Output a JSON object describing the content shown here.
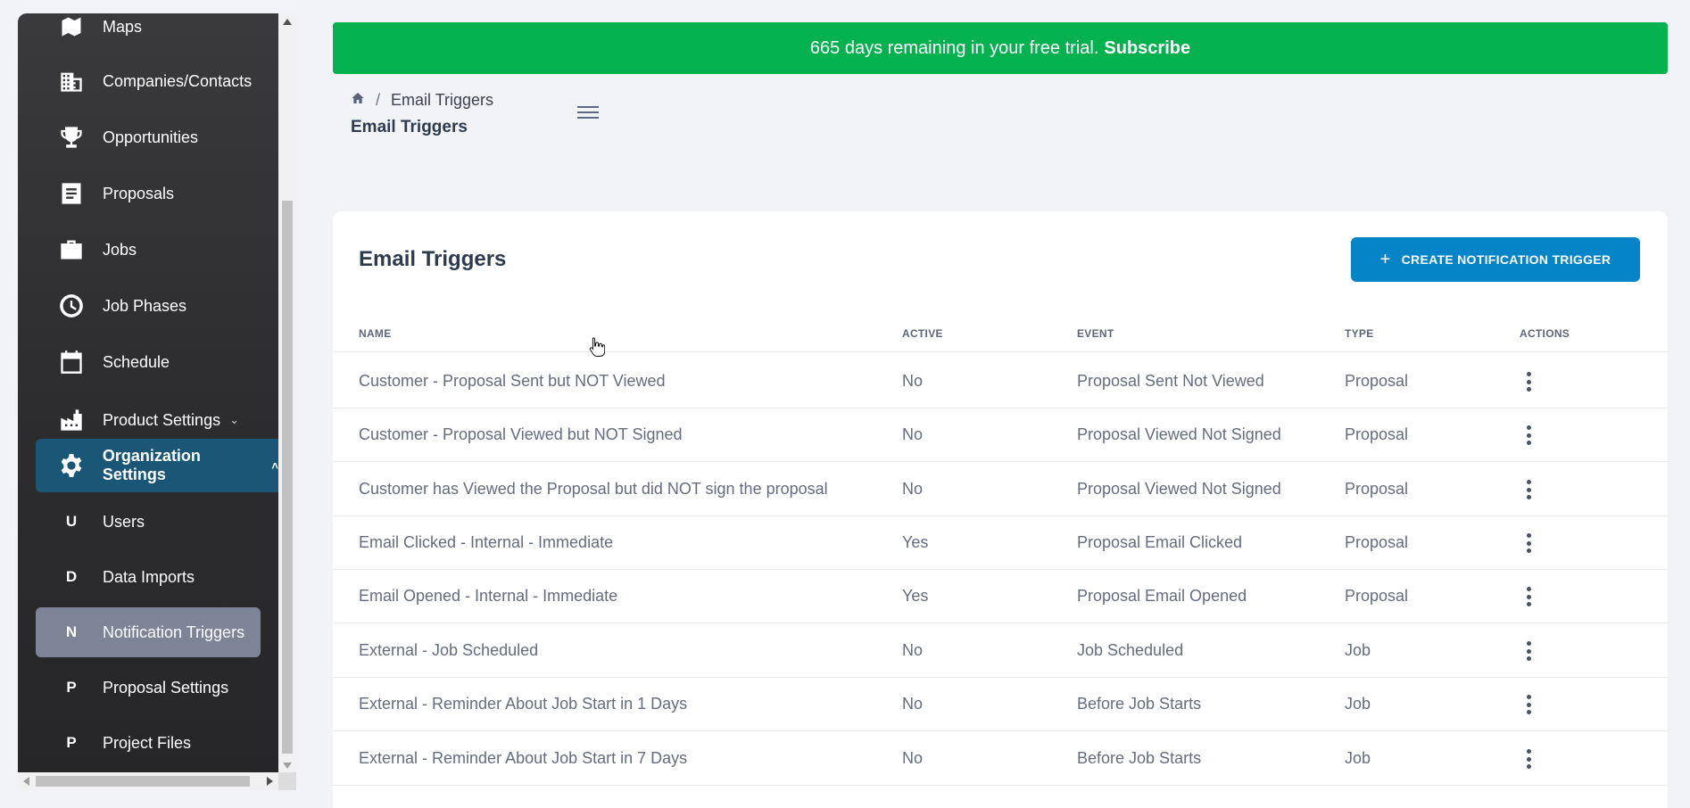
{
  "sidebar": {
    "items": [
      {
        "label": "Maps",
        "icon": "map-icon"
      },
      {
        "label": "Companies/Contacts",
        "icon": "building-icon"
      },
      {
        "label": "Opportunities",
        "icon": "trophy-icon"
      },
      {
        "label": "Proposals",
        "icon": "document-icon"
      },
      {
        "label": "Jobs",
        "icon": "briefcase-icon"
      },
      {
        "label": "Job Phases",
        "icon": "clock-icon"
      },
      {
        "label": "Schedule",
        "icon": "calendar-icon"
      },
      {
        "label": "Product Settings",
        "icon": "factory-icon"
      },
      {
        "label": "Organization Settings",
        "icon": "gear-icon"
      }
    ],
    "subitems": [
      {
        "letter": "U",
        "label": "Users"
      },
      {
        "letter": "D",
        "label": "Data Imports"
      },
      {
        "letter": "N",
        "label": "Notification Triggers"
      },
      {
        "letter": "P",
        "label": "Proposal Settings"
      },
      {
        "letter": "P",
        "label": "Project Files"
      }
    ]
  },
  "banner": {
    "text": "665 days remaining in your free trial.",
    "link": "Subscribe",
    "color": "#03b24f"
  },
  "breadcrumb": {
    "current": "Email Triggers"
  },
  "page_title": "Email Triggers",
  "card": {
    "title": "Email Triggers",
    "create_button": "CREATE NOTIFICATION TRIGGER"
  },
  "table": {
    "headers": {
      "name": "NAME",
      "active": "ACTIVE",
      "event": "EVENT",
      "type": "TYPE",
      "actions": "ACTIONS"
    },
    "rows": [
      {
        "name": "Customer - Proposal Sent but NOT Viewed",
        "active": "No",
        "event": "Proposal Sent Not Viewed",
        "type": "Proposal"
      },
      {
        "name": "Customer - Proposal Viewed but NOT Signed",
        "active": "No",
        "event": "Proposal Viewed Not Signed",
        "type": "Proposal"
      },
      {
        "name": "Customer has Viewed the Proposal but did NOT sign the proposal",
        "active": "No",
        "event": "Proposal Viewed Not Signed",
        "type": "Proposal"
      },
      {
        "name": "Email Clicked - Internal - Immediate",
        "active": "Yes",
        "event": "Proposal Email Clicked",
        "type": "Proposal"
      },
      {
        "name": "Email Opened - Internal - Immediate",
        "active": "Yes",
        "event": "Proposal Email Opened",
        "type": "Proposal"
      },
      {
        "name": "External - Job Scheduled",
        "active": "No",
        "event": "Job Scheduled",
        "type": "Job"
      },
      {
        "name": "External - Reminder About Job Start in 1 Days",
        "active": "No",
        "event": "Before Job Starts",
        "type": "Job"
      },
      {
        "name": "External - Reminder About Job Start in 7 Days",
        "active": "No",
        "event": "Before Job Starts",
        "type": "Job"
      }
    ]
  },
  "colors": {
    "accent": "#0684c8",
    "sidebar_active": "#1a5676",
    "sidebar_selected": "#7d8498"
  }
}
